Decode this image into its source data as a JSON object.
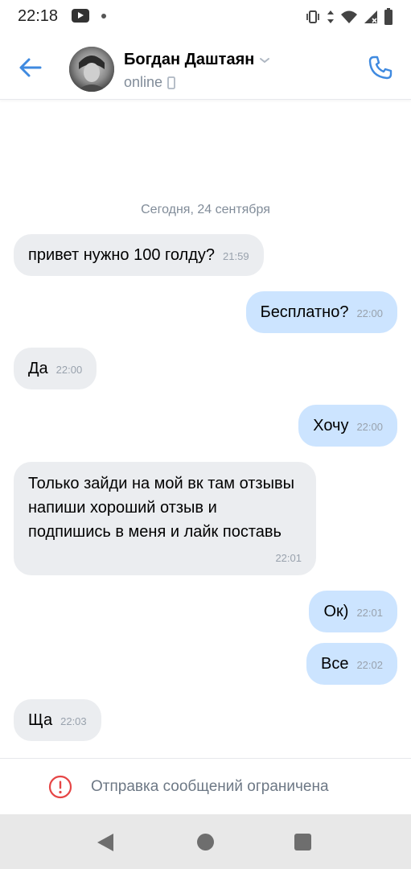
{
  "status_bar": {
    "time": "22:18",
    "icons": [
      "youtube-icon",
      "notification-dot-icon",
      "vibrate-icon",
      "data-arrows-icon",
      "wifi-icon",
      "signal-icon",
      "battery-icon"
    ]
  },
  "header": {
    "contact_name": "Богдан Даштаян",
    "status": "online",
    "icons": [
      "back-arrow-icon",
      "chevron-down-icon",
      "mobile-device-icon",
      "phone-call-icon"
    ],
    "accent_color": "#3f8ae0"
  },
  "chat": {
    "date_separator": "Сегодня, 24 сентября",
    "messages": [
      {
        "direction": "in",
        "text": "привет нужно 100 голду?",
        "time": "21:59"
      },
      {
        "direction": "out",
        "text": "Бесплатно?",
        "time": "22:00"
      },
      {
        "direction": "in",
        "text": "Да",
        "time": "22:00"
      },
      {
        "direction": "out",
        "text": "Хочу",
        "time": "22:00"
      },
      {
        "direction": "in",
        "text": "Только зайди на мой вк там отзывы напиши хороший отзыв и подпишись в меня и лайк поставь",
        "time": "22:01"
      },
      {
        "direction": "out",
        "text": "Ок)",
        "time": "22:01"
      },
      {
        "direction": "out",
        "text": "Все",
        "time": "22:02"
      },
      {
        "direction": "in",
        "text": "Ща",
        "time": "22:03"
      }
    ],
    "incoming_bubble_color": "#ebedf0",
    "outgoing_bubble_color": "#cce4ff"
  },
  "footer": {
    "restriction_text": "Отправка сообщений ограничена",
    "restriction_icon": "error-circle-icon",
    "restriction_color": "#e64646"
  },
  "nav_bar": {
    "icons": [
      "nav-back-icon",
      "nav-home-icon",
      "nav-recents-icon"
    ]
  }
}
